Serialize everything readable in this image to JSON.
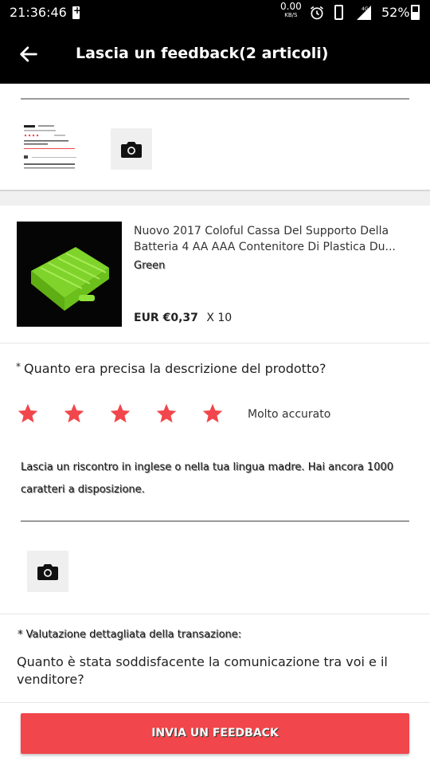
{
  "status_bar": {
    "time": "21:36:46",
    "net_speed_value": "0.00",
    "net_speed_unit": "KB/S",
    "network_type": "4G",
    "battery_percent": "52%",
    "battery_level": 0.52
  },
  "app_bar": {
    "title": "Lascia un feedback(2 articoli)",
    "back_icon": "arrow-back-icon"
  },
  "photo_section_1": {
    "camera_icon": "camera-icon"
  },
  "product": {
    "title": "Nuovo 2017 Coloful Cassa Del Supporto Della Batteria 4 AA AAA Contenitore Di Plastica Du...",
    "variant": "Green",
    "price": "EUR €0,37",
    "quantity": "X 10"
  },
  "rating": {
    "asterisk": "*",
    "question": "Quanto era precisa la descrizione del prodotto?",
    "stars_filled": 5,
    "stars_total": 5,
    "label": "Molto accurato",
    "star_color": "#f1464b"
  },
  "feedback_input": {
    "placeholder": "Lascia un riscontro in inglese o nella tua lingua madre. Hai ancora 1000 caratteri a disposizione."
  },
  "photo_section_2": {
    "camera_icon": "camera-icon"
  },
  "detail": {
    "heading": "* Valutazione dettagliata della transazione:",
    "question": "Quanto è stata soddisfacente la comunicazione tra voi e il venditore?"
  },
  "submit": {
    "label": "INVIA UN FEEDBACK",
    "color": "#f1464b"
  }
}
